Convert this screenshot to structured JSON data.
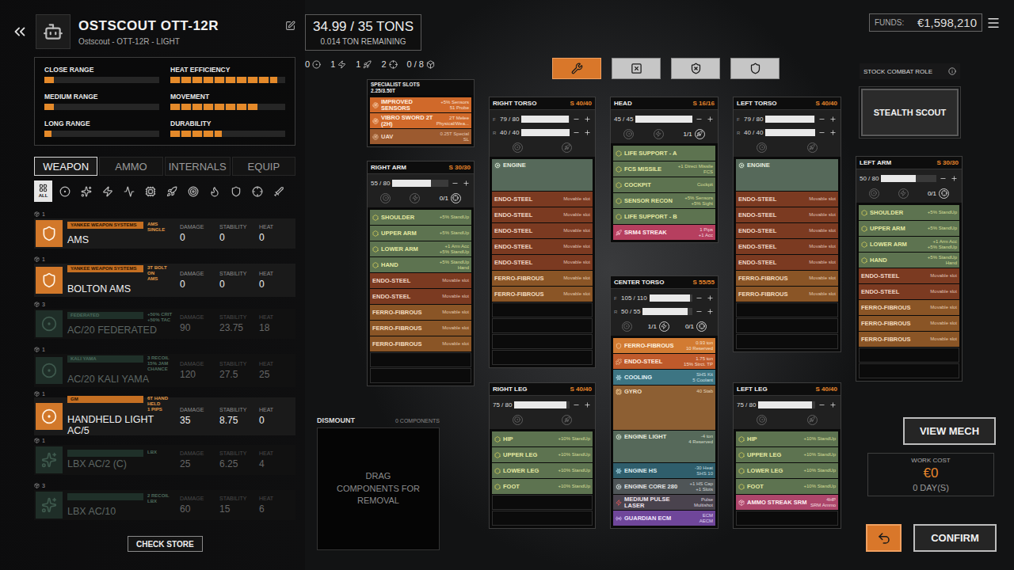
{
  "header": {
    "title": "OSTSCOUT OTT-12R",
    "subtitle": "Ostscout - OTT-12R - LIGHT"
  },
  "stats": [
    {
      "label": "CLOSE RANGE",
      "level": 0.08
    },
    {
      "label": "HEAT EFFICIENCY",
      "level": 0.93
    },
    {
      "label": "MEDIUM RANGE",
      "level": 0.08
    },
    {
      "label": "MOVEMENT",
      "level": 0.77
    },
    {
      "label": "LONG RANGE",
      "level": 0.06
    },
    {
      "label": "DURABILITY",
      "level": 0.45
    }
  ],
  "tabs": [
    {
      "label": "WEAPON",
      "selected": true
    },
    {
      "label": "AMMO",
      "selected": false
    },
    {
      "label": "INTERNALS",
      "selected": false
    },
    {
      "label": "EQUIP",
      "selected": false
    }
  ],
  "filters": [
    {
      "kind": "all",
      "label": "ALL",
      "selected": true
    },
    {
      "kind": "ballistic",
      "selected": false
    },
    {
      "kind": "lbx",
      "selected": false
    },
    {
      "kind": "laser",
      "selected": false
    },
    {
      "kind": "pulse",
      "selected": false
    },
    {
      "kind": "ppc",
      "selected": false
    },
    {
      "kind": "missile",
      "selected": false
    },
    {
      "kind": "streak",
      "selected": false
    },
    {
      "kind": "flamer",
      "selected": false
    },
    {
      "kind": "ams",
      "selected": false
    },
    {
      "kind": "tag",
      "selected": false
    },
    {
      "kind": "melee",
      "selected": false
    }
  ],
  "weaponColumns": [
    "DAMAGE",
    "STABILITY",
    "HEAT"
  ],
  "weapons": [
    {
      "count": "1",
      "kind": "ams",
      "maker": "YANKEE WEAPON SYSTEMS",
      "tag": [
        "AMS",
        "SINGLE"
      ],
      "name": "AMS",
      "damage": "0",
      "stability": "0",
      "heat": "0",
      "available": true
    },
    {
      "count": "1",
      "kind": "ams",
      "maker": "YANKEE WEAPON SYSTEMS",
      "tag": [
        "3T BOLT ON",
        "AMS"
      ],
      "name": "BOLTON AMS",
      "damage": "0",
      "stability": "0",
      "heat": "0",
      "available": true
    },
    {
      "count": "3",
      "kind": "ballistic",
      "maker": "FEDERATED",
      "tag": [
        "+50% CRIT",
        "+50% TAC"
      ],
      "name": "AC/20 FEDERATED",
      "damage": "90",
      "stability": "23.75",
      "heat": "18",
      "available": false
    },
    {
      "count": "1",
      "kind": "ballistic",
      "maker": "KALI YAMA",
      "tag": [
        "3 RECOIL",
        "15% JAM",
        "CHANCE"
      ],
      "name": "AC/20 KALI YAMA",
      "damage": "120",
      "stability": "27.5",
      "heat": "25",
      "available": false
    },
    {
      "count": "1",
      "kind": "ballistic",
      "maker": "GM",
      "tag": [
        "6T HAND HELD",
        "1 PIPS"
      ],
      "name": "HANDHELD LIGHT AC/5",
      "damage": "35",
      "stability": "8.75",
      "heat": "0",
      "available": true
    },
    {
      "count": "1",
      "kind": "lbx",
      "maker": "",
      "tag": [
        "LBX"
      ],
      "name": "LBX AC/2 (C)",
      "damage": "25",
      "stability": "6.25",
      "heat": "4",
      "available": false
    },
    {
      "count": "3",
      "kind": "lbx",
      "maker": "",
      "tag": [
        "2 RECOIL",
        "LBX"
      ],
      "name": "LBX AC/10",
      "damage": "60",
      "stability": "15",
      "heat": "6",
      "available": false
    }
  ],
  "checkStore": "CHECK STORE",
  "tonnage": {
    "value": "34.99 / 35 TONS",
    "remaining": "0.014 TON REMAINING"
  },
  "totals": [
    {
      "kind": "ballistic",
      "count": "0"
    },
    {
      "kind": "energy",
      "count": "1"
    },
    {
      "kind": "missile",
      "count": "1"
    },
    {
      "kind": "support",
      "count": "2"
    },
    {
      "kind": "equipment",
      "count": "0 / 8"
    }
  ],
  "toolbar": [
    {
      "kind": "wrench",
      "selected": true
    },
    {
      "kind": "armor-x",
      "selected": false
    },
    {
      "kind": "shield-x",
      "selected": false
    },
    {
      "kind": "shield",
      "selected": false
    }
  ],
  "funds": {
    "label": "FUNDS:",
    "value": "€1,598,210"
  },
  "combatRole": {
    "label": "STOCK COMBAT ROLE",
    "value": "STEALTH SCOUT"
  },
  "specialist": {
    "title": "SPECIALIST SLOTS",
    "capacity": "2.25/3.50T",
    "slots": [
      {
        "name": "IMPROVED SENSORS",
        "desc": [
          "+5% Sensors",
          "51 Probe"
        ],
        "kind": "special"
      },
      {
        "name": "VIBRO SWORD 2T (2H)",
        "desc": [
          "2T Melee",
          "Physical/Wea..."
        ],
        "kind": "special"
      },
      {
        "name": "UAV",
        "desc": [
          "0.25T Special",
          "SL"
        ],
        "kind": "special-dim"
      }
    ]
  },
  "sections": {
    "right_arm": {
      "title": "RIGHT ARM",
      "structure": "S 30/30",
      "armor": [
        {
          "value": "55 / 80",
          "level": 0.69
        }
      ],
      "hardpoints": [
        {
          "kind": "ballistic"
        },
        {
          "kind": "energy"
        },
        {
          "kind": "support",
          "count": "0/1"
        }
      ],
      "slots": [
        {
          "name": "SHOULDER",
          "desc": [
            "+5% StandUp"
          ],
          "kind": "structure"
        },
        {
          "name": "UPPER ARM",
          "desc": [
            "+5% StandUp"
          ],
          "kind": "structure"
        },
        {
          "name": "LOWER ARM",
          "desc": [
            "+1 Arm Acc",
            "+5% StandUp"
          ],
          "kind": "structure"
        },
        {
          "name": "HAND",
          "desc": [
            "+5% StandUp",
            "Hand"
          ],
          "kind": "structure"
        },
        {
          "name": "ENDO-STEEL",
          "desc": [
            "Movable slot"
          ],
          "kind": "endo"
        },
        {
          "name": "ENDO-STEEL",
          "desc": [
            "Movable slot"
          ],
          "kind": "endo"
        },
        {
          "name": "FERRO-FIBROUS",
          "desc": [
            "Movable slot"
          ],
          "kind": "ferro"
        },
        {
          "name": "FERRO-FIBROUS",
          "desc": [
            "Movable slot"
          ],
          "kind": "ferro"
        },
        {
          "name": "FERRO-FIBROUS",
          "desc": [
            "Movable slot"
          ],
          "kind": "ferro"
        },
        {
          "kind": "empty"
        },
        {
          "kind": "empty"
        }
      ]
    },
    "right_torso": {
      "title": "RIGHT TORSO",
      "structure": "S 40/40",
      "armor": [
        {
          "label": "F",
          "value": "79 / 80",
          "level": 0.99
        },
        {
          "label": "R",
          "value": "40 / 40",
          "level": 1
        }
      ],
      "hardpoints": [
        {
          "kind": "ballistic"
        },
        {
          "kind": "missile"
        }
      ],
      "slots": [
        {
          "name": "ENGINE",
          "desc": [],
          "kind": "engine"
        },
        {
          "name": "ENDO-STEEL",
          "desc": [
            "Movable slot"
          ],
          "kind": "endo"
        },
        {
          "name": "ENDO-STEEL",
          "desc": [
            "Movable slot"
          ],
          "kind": "endo"
        },
        {
          "name": "ENDO-STEEL",
          "desc": [
            "Movable slot"
          ],
          "kind": "endo"
        },
        {
          "name": "ENDO-STEEL",
          "desc": [
            "Movable slot"
          ],
          "kind": "endo"
        },
        {
          "name": "ENDO-STEEL",
          "desc": [
            "Movable slot"
          ],
          "kind": "endo"
        },
        {
          "name": "FERRO-FIBROUS",
          "desc": [
            "Movable slot"
          ],
          "kind": "ferro"
        },
        {
          "name": "FERRO-FIBROUS",
          "desc": [
            "Movable slot"
          ],
          "kind": "ferro"
        },
        {
          "kind": "empty"
        },
        {
          "kind": "empty"
        },
        {
          "kind": "empty"
        },
        {
          "kind": "empty"
        }
      ]
    },
    "head": {
      "title": "HEAD",
      "structure": "S 16/16",
      "armor": [
        {
          "value": "45 / 45",
          "level": 1
        }
      ],
      "hardpoints": [
        {
          "kind": "ballistic"
        },
        {
          "kind": "energy"
        },
        {
          "kind": "missile",
          "count": "1/1"
        }
      ],
      "slots": [
        {
          "name": "LIFE SUPPORT - A",
          "desc": [],
          "kind": "structure"
        },
        {
          "name": "FCS MISSILE",
          "desc": [
            "+1 Direct Missile",
            "FCS"
          ],
          "kind": "structure"
        },
        {
          "name": "COCKPIT",
          "desc": [
            "Cockpit"
          ],
          "kind": "structure"
        },
        {
          "name": "SENSOR RECON",
          "desc": [
            "+5% Sensors",
            "+5% Sight"
          ],
          "kind": "structure"
        },
        {
          "name": "LIFE SUPPORT - B",
          "desc": [],
          "kind": "structure"
        },
        {
          "name": "SRM4 STREAK",
          "desc": [
            "1 Pips",
            "+1 Acc"
          ],
          "kind": "missile"
        }
      ]
    },
    "center_torso": {
      "title": "CENTER TORSO",
      "structure": "S 55/55",
      "armor": [
        {
          "label": "F",
          "value": "105 / 110",
          "level": 0.95
        },
        {
          "label": "R",
          "value": "50 / 55",
          "level": 0.91
        }
      ],
      "hardpoints": [
        {
          "kind": "ballistic"
        },
        {
          "kind": "energy",
          "count": "1/1"
        },
        {
          "kind": "support",
          "count": "0/1"
        }
      ],
      "slots": [
        {
          "name": "FERRO-FIBROUS",
          "desc": [
            "0.93 ton",
            "10 Reserved"
          ],
          "kind": "ferro-fixed"
        },
        {
          "name": "ENDO-STEEL",
          "desc": [
            "1.75 ton",
            "15% Strct. TP"
          ],
          "kind": "endo-fixed"
        },
        {
          "name": "COOLING",
          "desc": [
            "SHS Kit",
            "5 Coolant"
          ],
          "kind": "cooling"
        },
        {
          "name": "GYRO",
          "desc": [
            "40 Stab"
          ],
          "kind": "gyro"
        },
        {
          "name": "ENGINE LIGHT",
          "desc": [
            "-4 ton",
            "4 Reserved"
          ],
          "kind": "engine"
        },
        {
          "name": "ENGINE HS",
          "desc": [
            "-30 Heat",
            "SHS 10"
          ],
          "kind": "heatsink"
        },
        {
          "name": "ENGINE CORE 280",
          "desc": [
            "+1 HS Cap",
            "+1 Slots"
          ],
          "kind": "engine-part"
        },
        {
          "name": "MEDIUM PULSE LASER",
          "desc": [
            "Pulse",
            "Multishot"
          ],
          "kind": "energy"
        },
        {
          "name": "GUARDIAN ECM",
          "desc": [
            "ECM",
            "AECM"
          ],
          "kind": "ecm"
        }
      ]
    },
    "left_torso": {
      "title": "LEFT TORSO",
      "structure": "S 40/40",
      "armor": [
        {
          "label": "F",
          "value": "79 / 80",
          "level": 0.99
        },
        {
          "label": "R",
          "value": "40 / 40",
          "level": 1
        }
      ],
      "hardpoints": [
        {
          "kind": "ballistic"
        },
        {
          "kind": "missile"
        }
      ],
      "slots": [
        {
          "name": "ENGINE",
          "desc": [],
          "kind": "engine"
        },
        {
          "name": "ENDO-STEEL",
          "desc": [
            "Movable slot"
          ],
          "kind": "endo"
        },
        {
          "name": "ENDO-STEEL",
          "desc": [
            "Movable slot"
          ],
          "kind": "endo"
        },
        {
          "name": "ENDO-STEEL",
          "desc": [
            "Movable slot"
          ],
          "kind": "endo"
        },
        {
          "name": "ENDO-STEEL",
          "desc": [
            "Movable slot"
          ],
          "kind": "endo"
        },
        {
          "name": "ENDO-STEEL",
          "desc": [
            "Movable slot"
          ],
          "kind": "endo"
        },
        {
          "name": "FERRO-FIBROUS",
          "desc": [
            "Movable slot"
          ],
          "kind": "ferro"
        },
        {
          "name": "FERRO-FIBROUS",
          "desc": [
            "Movable slot"
          ],
          "kind": "ferro"
        },
        {
          "kind": "empty"
        },
        {
          "kind": "empty"
        },
        {
          "kind": "empty"
        }
      ]
    },
    "left_arm": {
      "title": "LEFT ARM",
      "structure": "S 30/30",
      "armor": [
        {
          "value": "50 / 80",
          "level": 0.62
        }
      ],
      "hardpoints": [
        {
          "kind": "ballistic"
        },
        {
          "kind": "energy"
        },
        {
          "kind": "support",
          "count": "0/1"
        }
      ],
      "slots": [
        {
          "name": "SHOULDER",
          "desc": [
            "+5% StandUp"
          ],
          "kind": "structure"
        },
        {
          "name": "UPPER ARM",
          "desc": [
            "+5% StandUp"
          ],
          "kind": "structure"
        },
        {
          "name": "LOWER ARM",
          "desc": [
            "+1 Arm Acc",
            "+5% StandUp"
          ],
          "kind": "structure"
        },
        {
          "name": "HAND",
          "desc": [
            "+5% StandUp",
            "Hand"
          ],
          "kind": "structure"
        },
        {
          "name": "ENDO-STEEL",
          "desc": [
            "Movable slot"
          ],
          "kind": "endo"
        },
        {
          "name": "ENDO-STEEL",
          "desc": [
            "Movable slot"
          ],
          "kind": "endo"
        },
        {
          "name": "FERRO-FIBROUS",
          "desc": [
            "Movable slot"
          ],
          "kind": "ferro"
        },
        {
          "name": "FERRO-FIBROUS",
          "desc": [
            "Movable slot"
          ],
          "kind": "ferro"
        },
        {
          "name": "FERRO-FIBROUS",
          "desc": [
            "Movable slot"
          ],
          "kind": "ferro"
        },
        {
          "kind": "empty"
        },
        {
          "kind": "empty"
        }
      ]
    },
    "right_leg": {
      "title": "RIGHT LEG",
      "structure": "S 40/40",
      "armor": [
        {
          "value": "75 / 80",
          "level": 0.94
        }
      ],
      "hardpoints": [
        {
          "kind": "ballistic"
        },
        {
          "kind": "missile"
        }
      ],
      "slots": [
        {
          "name": "HIP",
          "desc": [
            "+10% StandUp"
          ],
          "kind": "structure"
        },
        {
          "name": "UPPER LEG",
          "desc": [
            "+10% StandUp"
          ],
          "kind": "structure"
        },
        {
          "name": "LOWER LEG",
          "desc": [
            "+10% StandUp"
          ],
          "kind": "structure"
        },
        {
          "name": "FOOT",
          "desc": [
            "+10% StandUp"
          ],
          "kind": "structure"
        },
        {
          "kind": "empty"
        },
        {
          "kind": "empty"
        }
      ]
    },
    "left_leg": {
      "title": "LEFT LEG",
      "structure": "S 40/40",
      "armor": [
        {
          "value": "75 / 80",
          "level": 0.94
        }
      ],
      "hardpoints": [
        {
          "kind": "ballistic"
        },
        {
          "kind": "missile"
        }
      ],
      "slots": [
        {
          "name": "HIP",
          "desc": [
            "+10% StandUp"
          ],
          "kind": "structure"
        },
        {
          "name": "UPPER LEG",
          "desc": [
            "+10% StandUp"
          ],
          "kind": "structure"
        },
        {
          "name": "LOWER LEG",
          "desc": [
            "+10% StandUp"
          ],
          "kind": "structure"
        },
        {
          "name": "FOOT",
          "desc": [
            "+10% StandUp"
          ],
          "kind": "structure"
        },
        {
          "name": "AMMO STREAK SRM",
          "desc": [
            "4HP",
            "SRM Ammo"
          ],
          "kind": "ammo"
        },
        {
          "kind": "empty"
        }
      ]
    }
  },
  "dismount": {
    "title": "DISMOUNT",
    "count": "0 COMPONENTS",
    "hint": "DRAG COMPONENTS FOR REMOVAL"
  },
  "workCost": {
    "label": "WORK COST",
    "value": "€0",
    "days": "0 DAY(S)"
  },
  "buttons": {
    "viewMech": "VIEW MECH",
    "confirm": "CONFIRM"
  }
}
